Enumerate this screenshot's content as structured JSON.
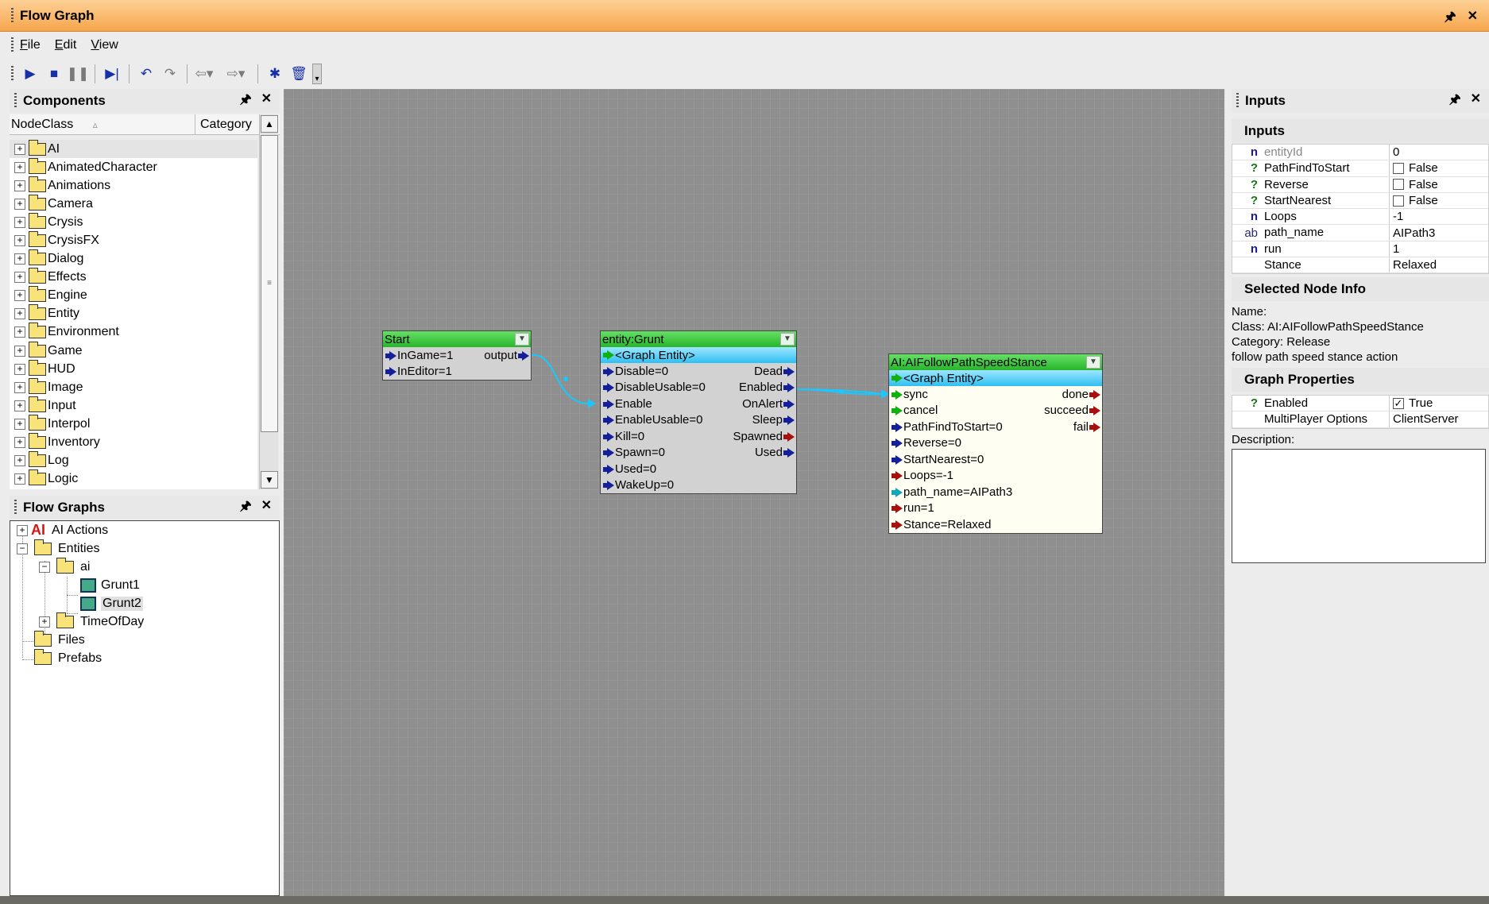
{
  "window": {
    "title": "Flow Graph"
  },
  "menu": [
    {
      "accel": "F",
      "rest": "ile"
    },
    {
      "accel": "E",
      "rest": "dit"
    },
    {
      "accel": "V",
      "rest": "iew"
    }
  ],
  "components": {
    "title": "Components",
    "col_nodeclass": "NodeClass",
    "col_category": "Category",
    "items": [
      "AI",
      "AnimatedCharacter",
      "Animations",
      "Camera",
      "Crysis",
      "CrysisFX",
      "Dialog",
      "Effects",
      "Engine",
      "Entity",
      "Environment",
      "Game",
      "HUD",
      "Image",
      "Input",
      "Interpol",
      "Inventory",
      "Log",
      "Logic"
    ]
  },
  "flowgraphs": {
    "title": "Flow Graphs",
    "ai_actions": "AI Actions",
    "ai_icon": "AI",
    "entities": "Entities",
    "ai_folder": "ai",
    "grunt1": "Grunt1",
    "grunt2": "Grunt2",
    "timeofday": "TimeOfDay",
    "files": "Files",
    "prefabs": "Prefabs"
  },
  "nodes": {
    "start": {
      "title": "Start",
      "in1": "InGame=1",
      "in2": "InEditor=1",
      "out1": "output"
    },
    "grunt": {
      "title": "entity:Grunt",
      "entity": "<Graph Entity>",
      "inputs": [
        "Disable=0",
        "DisableUsable=0",
        "Enable",
        "EnableUsable=0",
        "Kill=0",
        "Spawn=0",
        "Used=0",
        "WakeUp=0"
      ],
      "outputs": [
        "Dead",
        "Enabled",
        "OnAlert",
        "Sleep",
        "Spawned",
        "Used"
      ]
    },
    "ai": {
      "title": "AI:AIFollowPathSpeedStance",
      "entity": "<Graph Entity>",
      "inputs": [
        "sync",
        "cancel",
        "PathFindToStart=0",
        "Reverse=0",
        "StartNearest=0",
        "Loops=-1",
        "path_name=AIPath3",
        "run=1",
        "Stance=Relaxed"
      ],
      "outputs": [
        "done",
        "succeed",
        "fail"
      ]
    }
  },
  "inputs_panel": {
    "title": "Inputs",
    "section_inputs": "Inputs",
    "rows": [
      {
        "type": "n",
        "name": "entityId",
        "value": "0"
      },
      {
        "type": "?",
        "name": "PathFindToStart",
        "value": "False"
      },
      {
        "type": "?",
        "name": "Reverse",
        "value": "False"
      },
      {
        "type": "?",
        "name": "StartNearest",
        "value": "False"
      },
      {
        "type": "n",
        "name": "Loops",
        "value": "-1"
      },
      {
        "type": "ab",
        "name": "path_name",
        "value": "AIPath3"
      },
      {
        "type": "n",
        "name": "run",
        "value": "1"
      },
      {
        "type": "",
        "name": "Stance",
        "value": "Relaxed"
      }
    ],
    "section_info": "Selected Node Info",
    "info_name": "Name:",
    "info_class": "Class: AI:AIFollowPathSpeedStance",
    "info_category": "Category: Release",
    "info_desc": "follow path speed stance action",
    "section_graph": "Graph Properties",
    "graph_rows": [
      {
        "type": "?",
        "name": "Enabled",
        "value": "True"
      },
      {
        "type": "",
        "name": "MultiPlayer Options",
        "value": "ClientServer"
      }
    ],
    "description_label": "Description:"
  },
  "colors": {
    "titlebar": "#f6a54c",
    "canvas": "#8f8f8f",
    "node_title": "#27b52b",
    "entity_row": "#2ec0f2",
    "link": "#18c8ff"
  }
}
